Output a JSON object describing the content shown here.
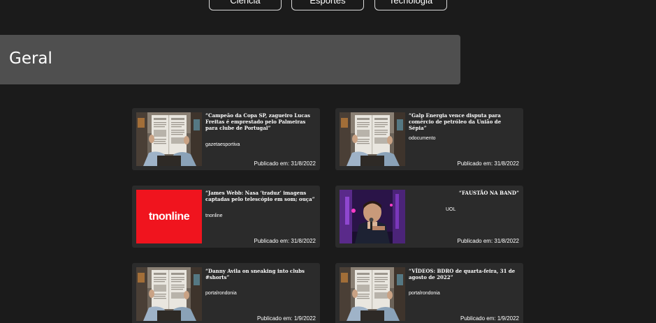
{
  "categories": [
    "Ciência",
    "Esportes",
    "Tecnologia"
  ],
  "section": {
    "title": "Geral"
  },
  "colors": {
    "background": "#1b1b1b",
    "header": "#4f4f4f",
    "card": "#2b2b2b",
    "tnonline_red": "#f0141e"
  },
  "articles": [
    {
      "headline": "“Campeão da Copa SP, zagueiro Lucas Freitas é emprestado pelo Palmeiras para clube de Portugal”",
      "source": "gazetaesportiva",
      "published": "Publicado em: 31/8/2022",
      "image": "newspaper-reader"
    },
    {
      "headline": "“Galp Energia vence disputa para comércio de petróleo da União de Sépia”",
      "source": "odocumento",
      "published": "Publicado em: 31/8/2022",
      "image": "newspaper-reader"
    },
    {
      "headline": "“James Webb: Nasa ‘traduz’ imagens captadas pelo telescópio em som; ouça”",
      "source": "tnonline",
      "published": "Publicado em: 31/8/2022",
      "image": "tnonline-logo",
      "logo_text": "tnonline"
    },
    {
      "headline": "“FAUSTÃO NA BAND”",
      "source": "UOL",
      "published": "Publicado em: 31/8/2022",
      "image": "tv-host-photo"
    },
    {
      "headline": "“Danny Avila on sneaking into clubs #shorts”",
      "source": "portalrondonia",
      "published": "Publicado em: 1/9/2022",
      "image": "newspaper-reader"
    },
    {
      "headline": "“VÍDEOS: BDRO de quarta-feira, 31 de agosto de 2022”",
      "source": "portalrondonia",
      "published": "Publicado em: 1/9/2022",
      "image": "newspaper-reader"
    }
  ]
}
